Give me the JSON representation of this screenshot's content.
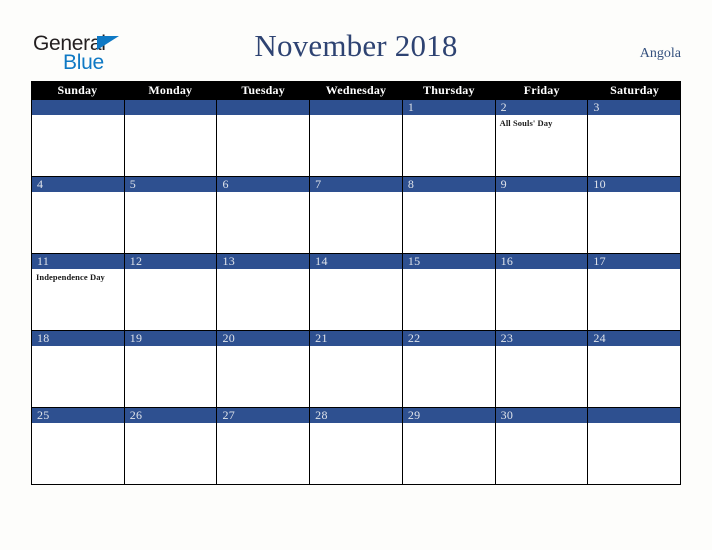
{
  "brand": {
    "name_part1": "General",
    "name_part2": "Blue",
    "triangle_icon": "triangle-icon",
    "color_dark": "#231f20",
    "color_blue": "#0f79c4"
  },
  "header": {
    "title": "November 2018",
    "country": "Angola",
    "title_color": "#2e4372"
  },
  "calendar": {
    "month": "November",
    "year": "2018",
    "weekdays": [
      "Sunday",
      "Monday",
      "Tuesday",
      "Wednesday",
      "Thursday",
      "Friday",
      "Saturday"
    ],
    "header_bg": "#000000",
    "band_color": "#2e5090",
    "weeks": [
      [
        {
          "num": "",
          "events": []
        },
        {
          "num": "",
          "events": []
        },
        {
          "num": "",
          "events": []
        },
        {
          "num": "",
          "events": []
        },
        {
          "num": "1",
          "events": []
        },
        {
          "num": "2",
          "events": [
            "All Souls' Day"
          ]
        },
        {
          "num": "3",
          "events": []
        }
      ],
      [
        {
          "num": "4",
          "events": []
        },
        {
          "num": "5",
          "events": []
        },
        {
          "num": "6",
          "events": []
        },
        {
          "num": "7",
          "events": []
        },
        {
          "num": "8",
          "events": []
        },
        {
          "num": "9",
          "events": []
        },
        {
          "num": "10",
          "events": []
        }
      ],
      [
        {
          "num": "11",
          "events": [
            "Independence Day"
          ]
        },
        {
          "num": "12",
          "events": []
        },
        {
          "num": "13",
          "events": []
        },
        {
          "num": "14",
          "events": []
        },
        {
          "num": "15",
          "events": []
        },
        {
          "num": "16",
          "events": []
        },
        {
          "num": "17",
          "events": []
        }
      ],
      [
        {
          "num": "18",
          "events": []
        },
        {
          "num": "19",
          "events": []
        },
        {
          "num": "20",
          "events": []
        },
        {
          "num": "21",
          "events": []
        },
        {
          "num": "22",
          "events": []
        },
        {
          "num": "23",
          "events": []
        },
        {
          "num": "24",
          "events": []
        }
      ],
      [
        {
          "num": "25",
          "events": []
        },
        {
          "num": "26",
          "events": []
        },
        {
          "num": "27",
          "events": []
        },
        {
          "num": "28",
          "events": []
        },
        {
          "num": "29",
          "events": []
        },
        {
          "num": "30",
          "events": []
        },
        {
          "num": "",
          "events": []
        }
      ]
    ]
  }
}
